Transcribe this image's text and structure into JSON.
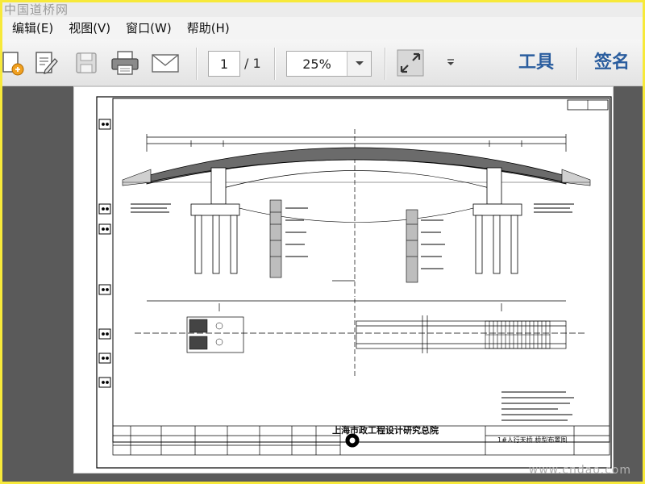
{
  "watermark_top": "中国道桥网",
  "menu": [
    {
      "label": "编辑(E)"
    },
    {
      "label": "视图(V)"
    },
    {
      "label": "窗口(W)"
    },
    {
      "label": "帮助(H)"
    }
  ],
  "toolbar": {
    "page_current": "1",
    "page_total": "/ 1",
    "zoom": "25%",
    "tools_label": "工具",
    "sign_label": "签名"
  },
  "document": {
    "institute_name": "上海市政工程设计研究总院",
    "sheet_name": "1#人行天桥  桥型布置图"
  },
  "watermark_bottom": "www.cndao.com",
  "colors": {
    "border": "#f7e93a",
    "viewer_bg": "#5a5a5a",
    "accent_text": "#2a5d9e"
  }
}
